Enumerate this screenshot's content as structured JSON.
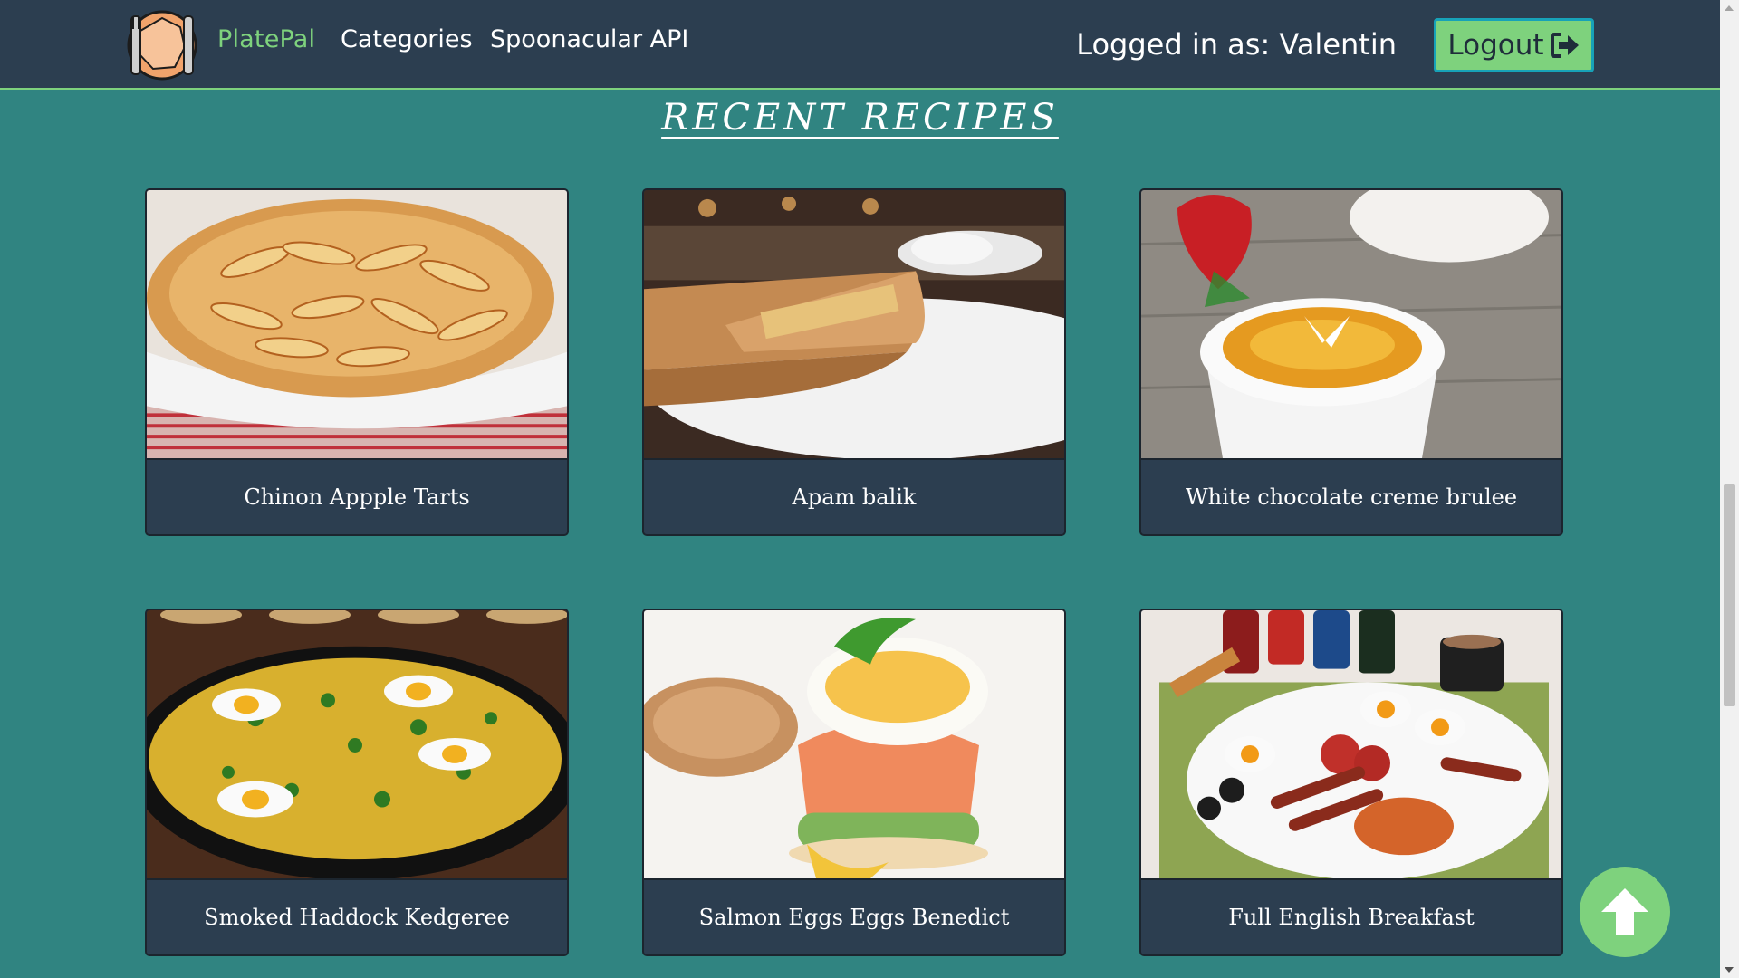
{
  "nav": {
    "brand": "PlatePal",
    "links": [
      "Categories",
      "Spoonacular API"
    ],
    "user_label": "Logged in as: Valentin",
    "logout_label": "Logout",
    "logout_icon": "sign-out-icon"
  },
  "heading": "RECENT RECIPES",
  "recipes": [
    {
      "title": "Chinon Appple Tarts"
    },
    {
      "title": "Apam balik"
    },
    {
      "title": "White chocolate creme brulee"
    },
    {
      "title": "Smoked Haddock Kedgeree"
    },
    {
      "title": "Salmon Eggs Eggs Benedict"
    },
    {
      "title": "Full English Breakfast"
    }
  ],
  "colors": {
    "background": "#308481",
    "navbar": "#2c3e50",
    "accent": "#7ed27d",
    "card": "#2c3e50"
  },
  "scroll_top_icon": "arrow-up-icon"
}
